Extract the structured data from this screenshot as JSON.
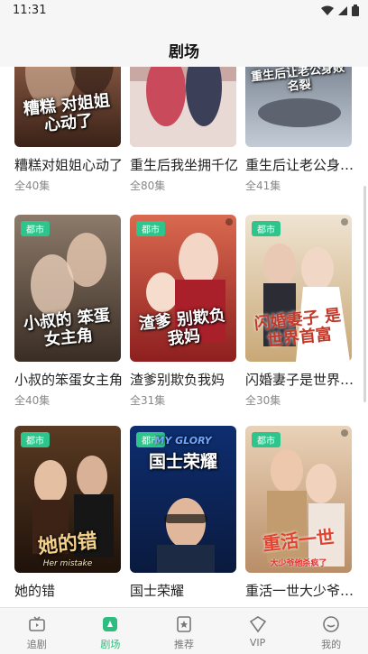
{
  "status_bar": {
    "time": "11:31"
  },
  "header": {
    "title": "剧场"
  },
  "colors": {
    "accent": "#2dbd7e",
    "tag": "#2dc58b"
  },
  "shows": [
    {
      "title": "糟糕对姐姐心动了",
      "episodes": "全40集",
      "tag": "",
      "poster_title": "糟糕 对姐姐心动了",
      "poster_sub": ""
    },
    {
      "title": "重生后我坐拥千亿",
      "episodes": "全80集",
      "tag": "",
      "poster_title": "",
      "poster_sub": ""
    },
    {
      "title": "重生后让老公身败名裂",
      "episodes": "全41集",
      "tag": "",
      "poster_title": "重生后让老公身败名裂",
      "poster_sub": ""
    },
    {
      "title": "小叔的笨蛋女主角",
      "episodes": "全40集",
      "tag": "都市",
      "poster_title": "小叔的 笨蛋女主角",
      "poster_sub": ""
    },
    {
      "title": "渣爹别欺负我妈",
      "episodes": "全31集",
      "tag": "都市",
      "poster_title": "渣爹 别欺负我妈",
      "poster_sub": ""
    },
    {
      "title": "闪婚妻子是世界首富",
      "episodes": "全30集",
      "tag": "都市",
      "poster_title": "闪婚妻子 是世界首富",
      "poster_sub": ""
    },
    {
      "title": "她的错",
      "episodes": "",
      "tag": "都市",
      "poster_title": "她的错",
      "poster_sub": "Her mistake"
    },
    {
      "title": "国士荣耀",
      "episodes": "",
      "tag": "都市",
      "poster_title": "国士荣耀",
      "poster_sub": "MY GLORY"
    },
    {
      "title": "重活一世大少爷他杀疯了",
      "episodes": "",
      "tag": "都市",
      "poster_title": "重活一世",
      "poster_sub": "大少爷他杀疯了"
    }
  ],
  "bottom_nav": [
    {
      "label": "追剧",
      "icon": "tv-icon",
      "active": false
    },
    {
      "label": "剧场",
      "icon": "theater-icon",
      "active": true
    },
    {
      "label": "推荐",
      "icon": "recommend-icon",
      "active": false
    },
    {
      "label": "VIP",
      "icon": "vip-icon",
      "active": false
    },
    {
      "label": "我的",
      "icon": "profile-icon",
      "active": false
    }
  ]
}
